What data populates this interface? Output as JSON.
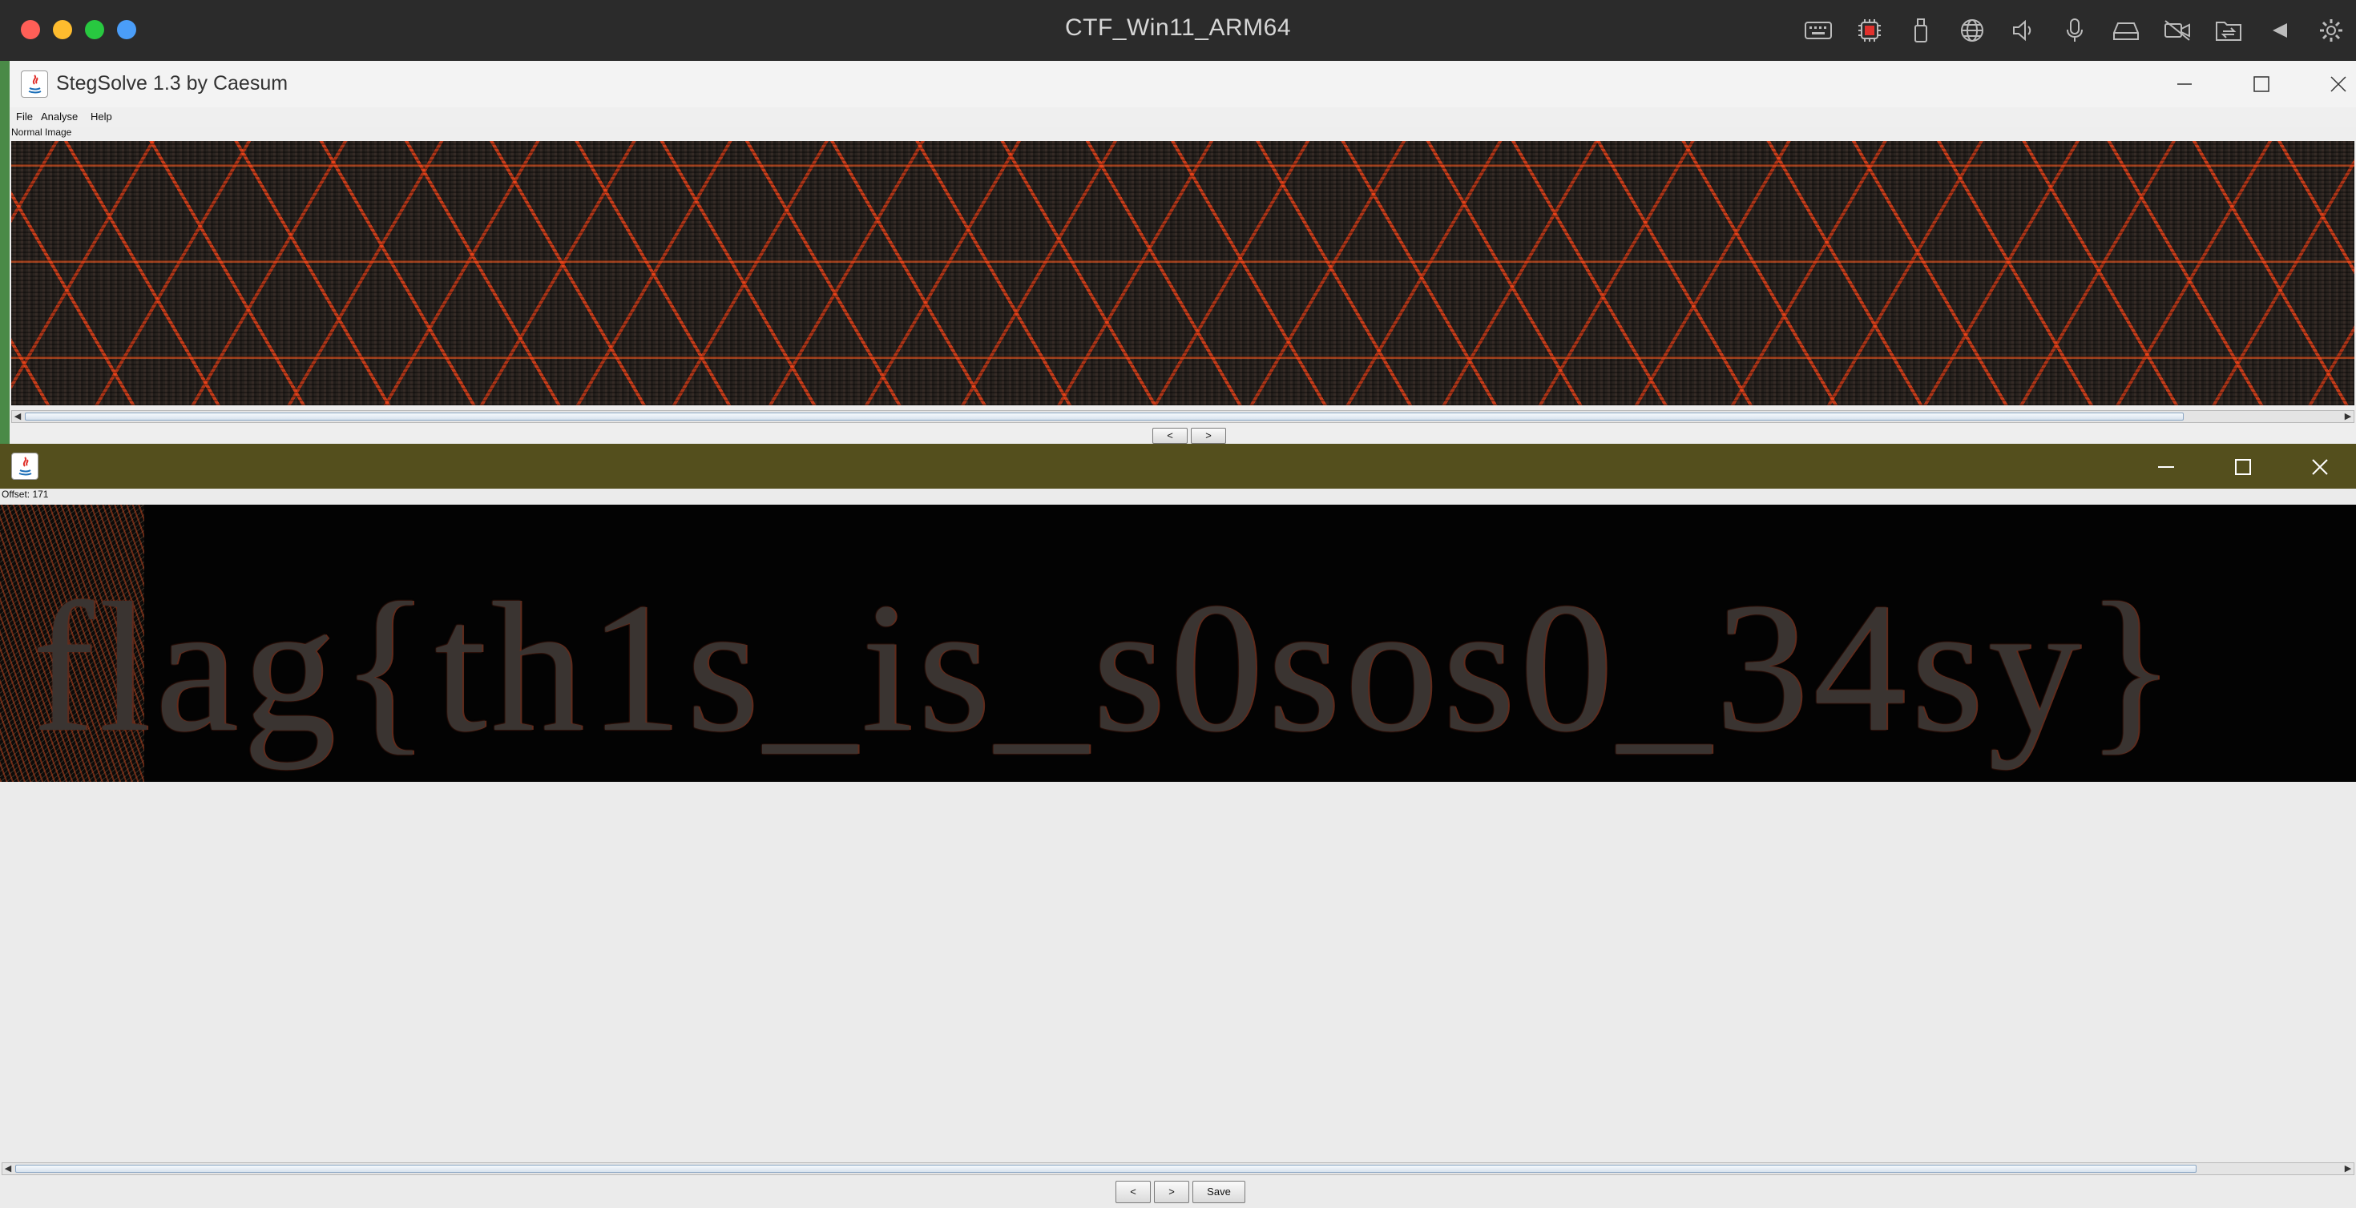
{
  "host": {
    "title": "CTF_Win11_ARM64",
    "traffic_colors": [
      "#ff5f57",
      "#febc2e",
      "#28c840",
      "#4a9df8"
    ],
    "toolbar_icons": [
      "keyboard-icon",
      "cpu-icon",
      "usb-icon",
      "network-icon",
      "volume-icon",
      "microphone-icon",
      "drive-icon",
      "camera-off-icon",
      "shared-folder-icon",
      "back-icon",
      "settings-icon"
    ]
  },
  "stegsolve": {
    "title": "StegSolve 1.3 by Caesum",
    "menu": [
      "File",
      "Analyse",
      "Help"
    ],
    "image_label": "Normal Image",
    "prev_label": "<",
    "next_label": ">"
  },
  "stereo": {
    "offset_label": "Offset: 171",
    "image_text": "flag{th1s_is_s0sos0_34sy}",
    "prev_label": "<",
    "next_label": ">",
    "save_label": "Save"
  }
}
